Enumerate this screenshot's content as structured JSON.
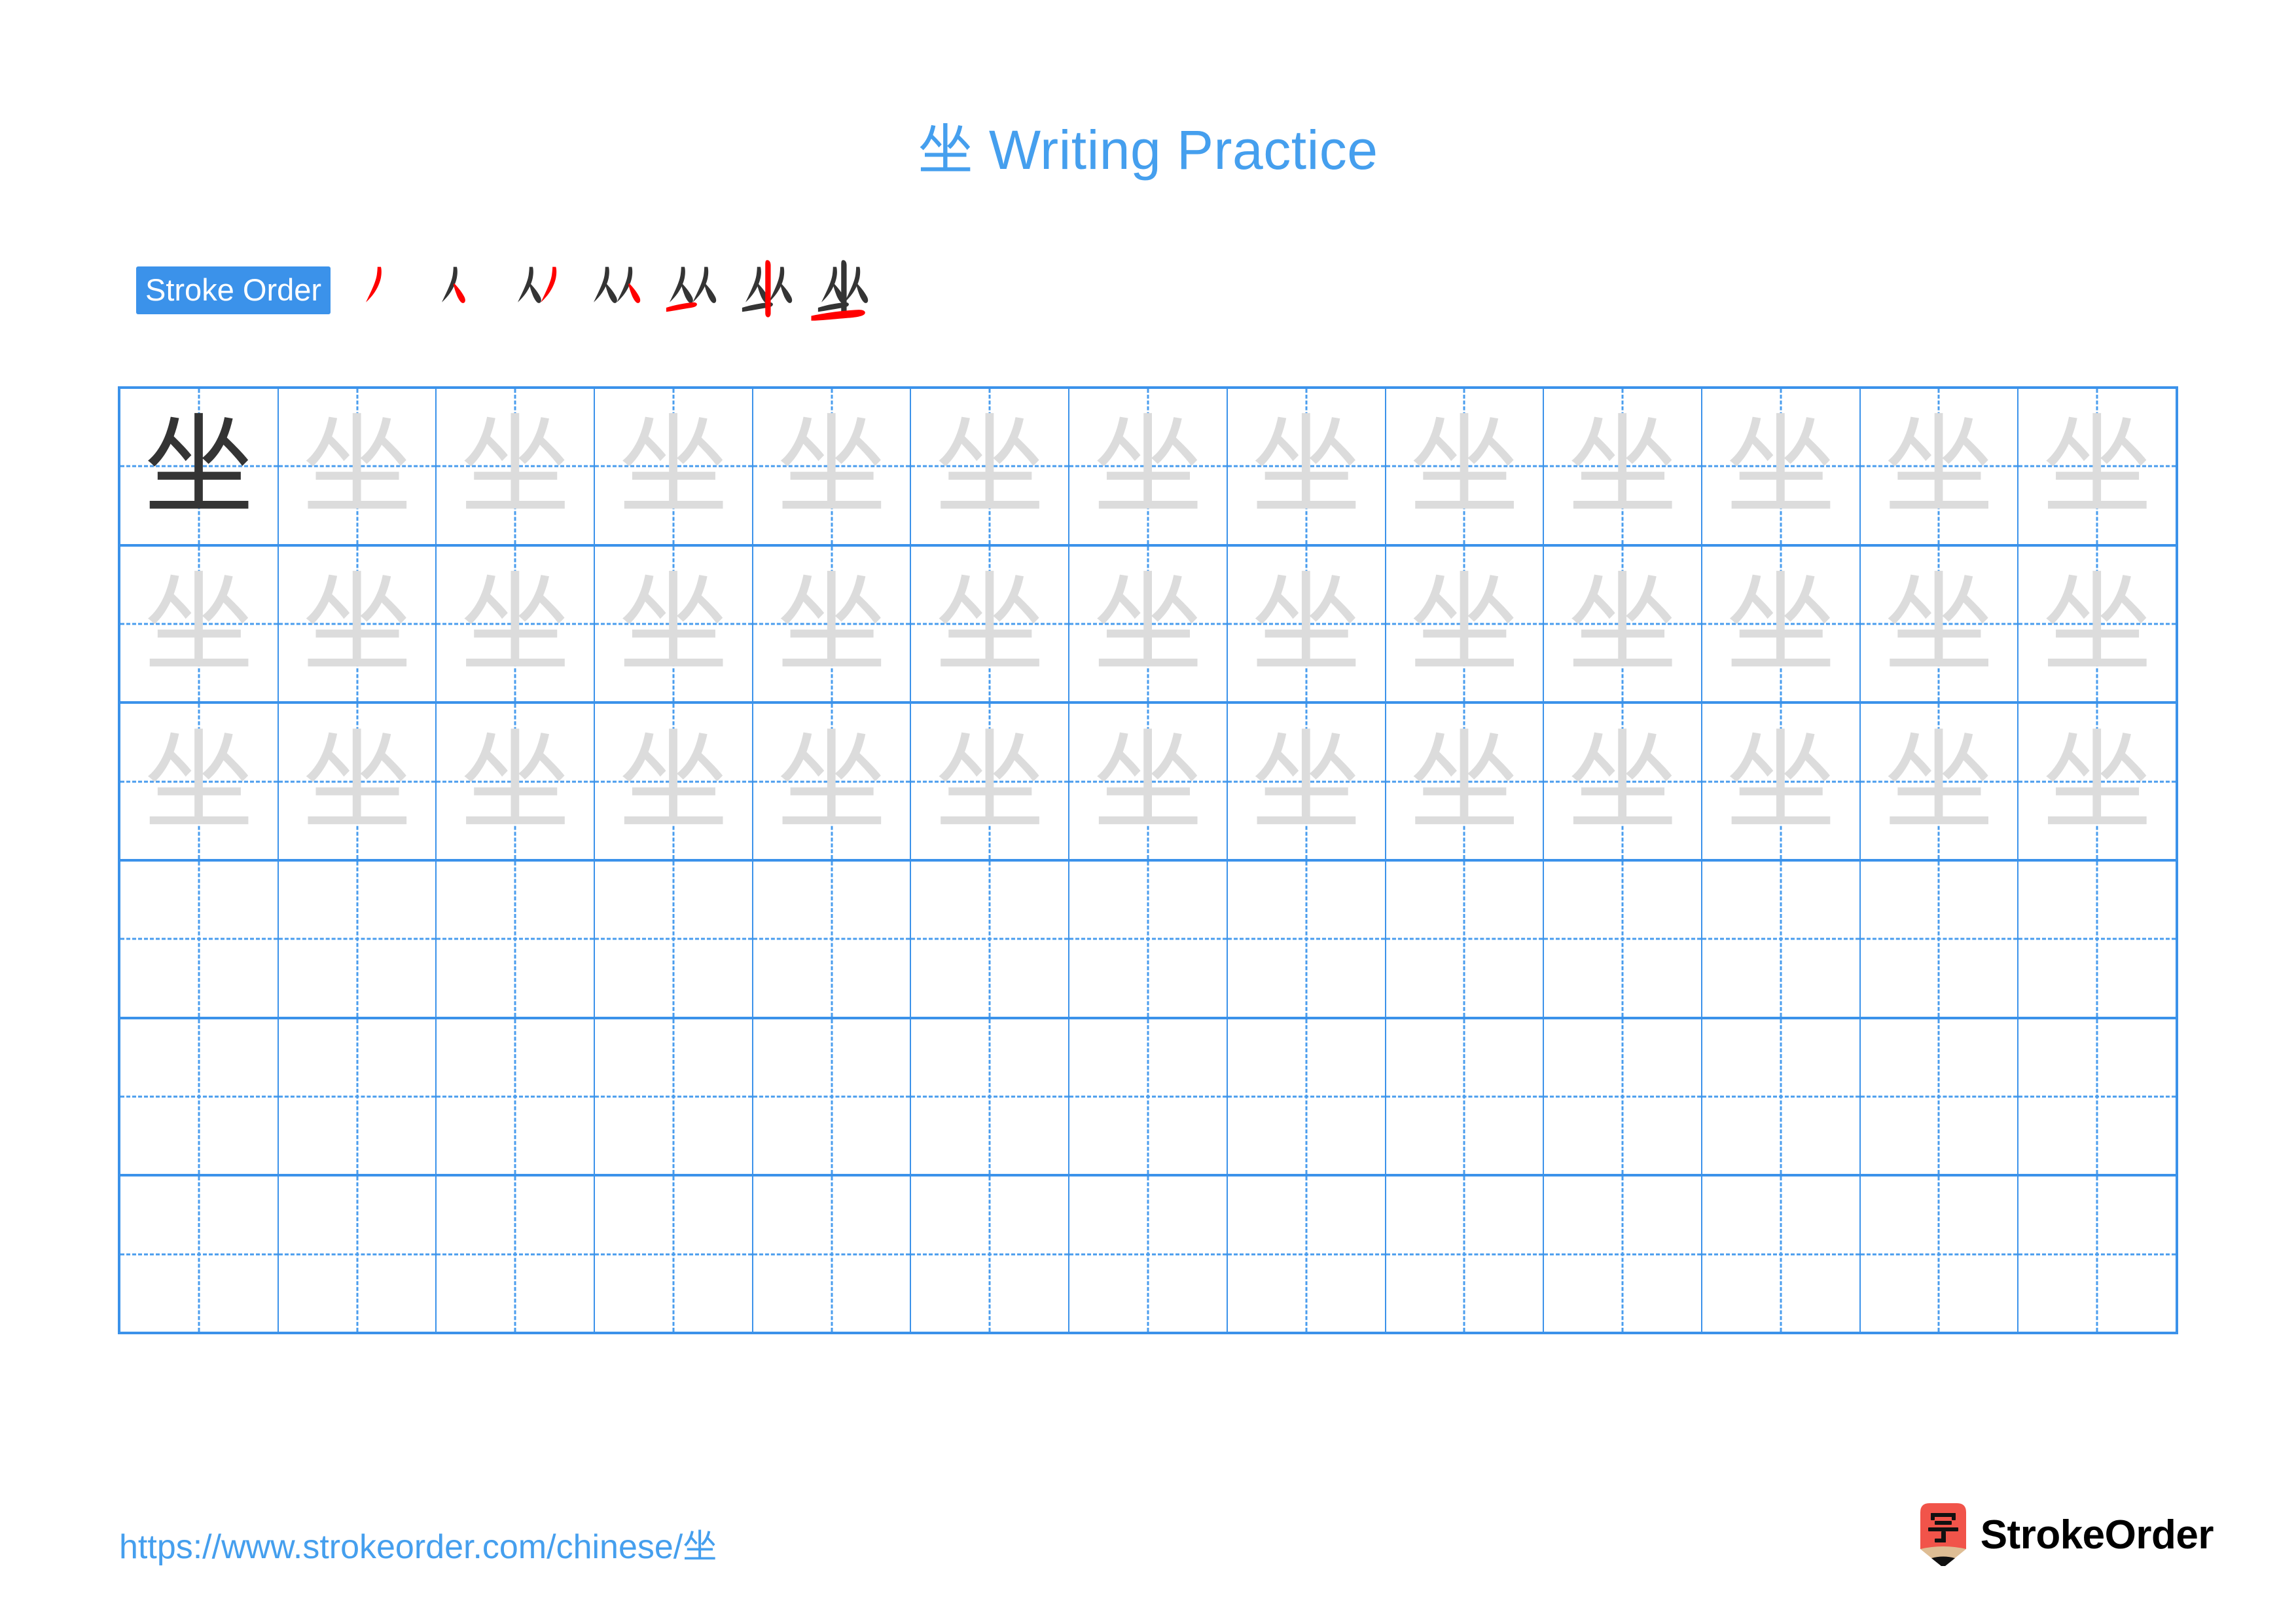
{
  "meta": {
    "character": "坐",
    "accent_blue": "#459FEE",
    "badge_blue": "#3B92EA",
    "grid_line_blue": "#3B92EA",
    "dash_blue": "#4A9DEE",
    "dark_ink": "#343434",
    "trace_ink": "#DCDCDC",
    "stroke_new_red": "#FF0000",
    "logo_red": "#F1544A",
    "logo_tan": "#DEBD94"
  },
  "header": {
    "title": "坐 Writing Practice"
  },
  "stroke_order": {
    "badge_label": "Stroke Order",
    "stroke_count": 7,
    "steps": [
      {
        "index": 1,
        "completed": "",
        "new_stroke": "丿"
      },
      {
        "index": 2,
        "completed": "丿",
        "new_stroke": "㇏"
      },
      {
        "index": 3,
        "completed": "人",
        "new_stroke": "丿"
      },
      {
        "index": 4,
        "completed": "人丿",
        "new_stroke": "㇏"
      },
      {
        "index": 5,
        "completed": "从",
        "new_stroke": "一"
      },
      {
        "index": 6,
        "completed": "丛",
        "new_stroke": "丨"
      },
      {
        "index": 7,
        "completed": "坐",
        "new_stroke": "一"
      }
    ]
  },
  "practice_grid": {
    "columns": 13,
    "rows": 6,
    "filled_rows": 3,
    "rows_data": [
      {
        "row": 1,
        "cells": [
          "坐",
          "坐",
          "坐",
          "坐",
          "坐",
          "坐",
          "坐",
          "坐",
          "坐",
          "坐",
          "坐",
          "坐",
          "坐"
        ],
        "styles": [
          "dark",
          "trace",
          "trace",
          "trace",
          "trace",
          "trace",
          "trace",
          "trace",
          "trace",
          "trace",
          "trace",
          "trace",
          "trace"
        ]
      },
      {
        "row": 2,
        "cells": [
          "坐",
          "坐",
          "坐",
          "坐",
          "坐",
          "坐",
          "坐",
          "坐",
          "坐",
          "坐",
          "坐",
          "坐",
          "坐"
        ],
        "styles": [
          "trace",
          "trace",
          "trace",
          "trace",
          "trace",
          "trace",
          "trace",
          "trace",
          "trace",
          "trace",
          "trace",
          "trace",
          "trace"
        ]
      },
      {
        "row": 3,
        "cells": [
          "坐",
          "坐",
          "坐",
          "坐",
          "坐",
          "坐",
          "坐",
          "坐",
          "坐",
          "坐",
          "坐",
          "坐",
          "坐"
        ],
        "styles": [
          "trace",
          "trace",
          "trace",
          "trace",
          "trace",
          "trace",
          "trace",
          "trace",
          "trace",
          "trace",
          "trace",
          "trace",
          "trace"
        ]
      },
      {
        "row": 4,
        "cells": [
          "",
          "",
          "",
          "",
          "",
          "",
          "",
          "",
          "",
          "",
          "",
          "",
          ""
        ],
        "styles": [
          "empty",
          "empty",
          "empty",
          "empty",
          "empty",
          "empty",
          "empty",
          "empty",
          "empty",
          "empty",
          "empty",
          "empty",
          "empty"
        ]
      },
      {
        "row": 5,
        "cells": [
          "",
          "",
          "",
          "",
          "",
          "",
          "",
          "",
          "",
          "",
          "",
          "",
          ""
        ],
        "styles": [
          "empty",
          "empty",
          "empty",
          "empty",
          "empty",
          "empty",
          "empty",
          "empty",
          "empty",
          "empty",
          "empty",
          "empty",
          "empty"
        ]
      },
      {
        "row": 6,
        "cells": [
          "",
          "",
          "",
          "",
          "",
          "",
          "",
          "",
          "",
          "",
          "",
          "",
          ""
        ],
        "styles": [
          "empty",
          "empty",
          "empty",
          "empty",
          "empty",
          "empty",
          "empty",
          "empty",
          "empty",
          "empty",
          "empty",
          "empty",
          "empty"
        ]
      }
    ]
  },
  "footer": {
    "url": "https://www.strokeorder.com/chinese/坐",
    "brand_name": "StrokeOrder",
    "brand_mark_glyph": "字"
  }
}
